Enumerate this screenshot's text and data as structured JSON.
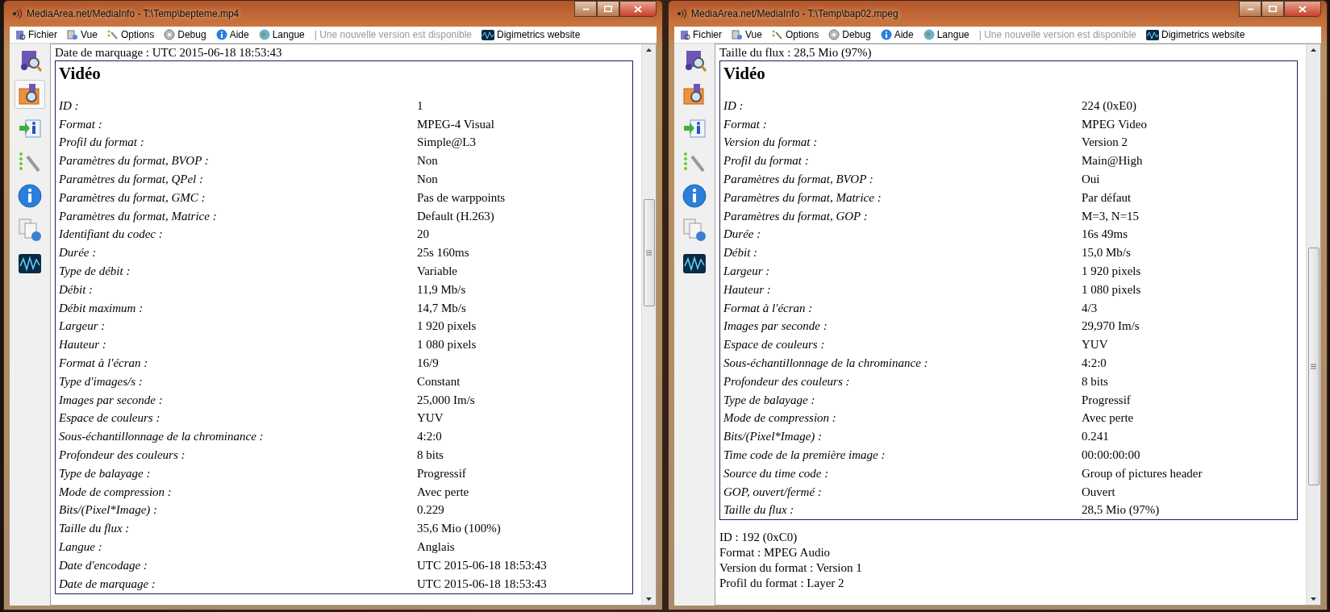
{
  "windows": [
    {
      "title": "MediaArea.net/MediaInfo - T:\\Temp\\bepteme.mp4",
      "menu": [
        {
          "kind": "fichier",
          "label": "Fichier"
        },
        {
          "kind": "vue",
          "label": "Vue"
        },
        {
          "kind": "options",
          "label": "Options"
        },
        {
          "kind": "debug",
          "label": "Debug"
        },
        {
          "kind": "aide",
          "label": "Aide"
        },
        {
          "kind": "langue",
          "label": "Langue"
        }
      ],
      "update_notice": "| Une nouvelle version est disponible",
      "website": "Digimetrics website",
      "sidebar": [
        {
          "selected": false
        },
        {
          "selected": true
        },
        {
          "selected": false
        },
        {
          "selected": false
        },
        {
          "selected": false
        },
        {
          "selected": false
        },
        {
          "selected": false
        }
      ],
      "header_line": "Date de marquage : UTC 2015-06-18 18:53:43",
      "section": {
        "title": "Vidéo",
        "rows": [
          {
            "label": "ID :",
            "value": "1"
          },
          {
            "label": "Format :",
            "value": "MPEG-4 Visual"
          },
          {
            "label": "Profil du format :",
            "value": "Simple@L3"
          },
          {
            "label": "Paramètres du format, BVOP :",
            "value": "Non"
          },
          {
            "label": "Paramètres du format, QPel :",
            "value": "Non"
          },
          {
            "label": "Paramètres du format, GMC :",
            "value": "Pas de warppoints"
          },
          {
            "label": "Paramètres du format, Matrice :",
            "value": "Default (H.263)"
          },
          {
            "label": "Identifiant du codec :",
            "value": "20"
          },
          {
            "label": "Durée :",
            "value": "25s 160ms"
          },
          {
            "label": "Type de débit :",
            "value": "Variable"
          },
          {
            "label": "Débit :",
            "value": "11,9 Mb/s"
          },
          {
            "label": "Débit maximum :",
            "value": "14,7 Mb/s"
          },
          {
            "label": "Largeur :",
            "value": "1 920 pixels"
          },
          {
            "label": "Hauteur :",
            "value": "1 080 pixels"
          },
          {
            "label": "Format à l'écran :",
            "value": "16/9"
          },
          {
            "label": "Type d'images/s :",
            "value": "Constant"
          },
          {
            "label": "Images par seconde :",
            "value": "25,000 Im/s"
          },
          {
            "label": "Espace de couleurs :",
            "value": "YUV"
          },
          {
            "label": "Sous-échantillonnage de la chrominance :",
            "value": "4:2:0"
          },
          {
            "label": "Profondeur des couleurs :",
            "value": "8 bits"
          },
          {
            "label": "Type de balayage :",
            "value": "Progressif"
          },
          {
            "label": "Mode de compression :",
            "value": "Avec perte"
          },
          {
            "label": "Bits/(Pixel*Image) :",
            "value": "0.229"
          },
          {
            "label": "Taille du flux :",
            "value": "35,6 Mio (100%)"
          },
          {
            "label": "Langue :",
            "value": "Anglais"
          },
          {
            "label": "Date d'encodage :",
            "value": "UTC 2015-06-18 18:53:43"
          },
          {
            "label": "Date de marquage :",
            "value": "UTC 2015-06-18 18:53:43"
          }
        ]
      }
    },
    {
      "title": "MediaArea.net/MediaInfo - T:\\Temp\\bap02.mpeg",
      "menu": [
        {
          "kind": "fichier",
          "label": "Fichier"
        },
        {
          "kind": "vue",
          "label": "Vue"
        },
        {
          "kind": "options",
          "label": "Options"
        },
        {
          "kind": "debug",
          "label": "Debug"
        },
        {
          "kind": "aide",
          "label": "Aide"
        },
        {
          "kind": "langue",
          "label": "Langue"
        }
      ],
      "update_notice": "| Une nouvelle version est disponible",
      "website": "Digimetrics website",
      "sidebar": [
        {
          "selected": false
        },
        {
          "selected": false
        },
        {
          "selected": false
        },
        {
          "selected": false
        },
        {
          "selected": false
        },
        {
          "selected": false
        },
        {
          "selected": false
        }
      ],
      "header_line": "Taille du flux : 28,5 Mio (97%)",
      "section": {
        "title": "Vidéo",
        "rows": [
          {
            "label": "ID :",
            "value": "224 (0xE0)"
          },
          {
            "label": "Format :",
            "value": "MPEG Video"
          },
          {
            "label": "Version du format :",
            "value": "Version 2"
          },
          {
            "label": "Profil du format :",
            "value": "Main@High"
          },
          {
            "label": "Paramètres du format, BVOP :",
            "value": "Oui"
          },
          {
            "label": "Paramètres du format, Matrice :",
            "value": "Par défaut"
          },
          {
            "label": "Paramètres du format, GOP :",
            "value": "M=3, N=15"
          },
          {
            "label": "Durée :",
            "value": "16s 49ms"
          },
          {
            "label": "Débit :",
            "value": "15,0 Mb/s"
          },
          {
            "label": "Largeur :",
            "value": "1 920 pixels"
          },
          {
            "label": "Hauteur :",
            "value": "1 080 pixels"
          },
          {
            "label": "Format à l'écran :",
            "value": "4/3"
          },
          {
            "label": "Images par seconde :",
            "value": "29,970 Im/s"
          },
          {
            "label": "Espace de couleurs :",
            "value": "YUV"
          },
          {
            "label": "Sous-échantillonnage de la chrominance :",
            "value": "4:2:0"
          },
          {
            "label": "Profondeur des couleurs :",
            "value": "8 bits"
          },
          {
            "label": "Type de balayage :",
            "value": "Progressif"
          },
          {
            "label": "Mode de compression :",
            "value": "Avec perte"
          },
          {
            "label": "Bits/(Pixel*Image) :",
            "value": "0.241"
          },
          {
            "label": "Time code de la première image :",
            "value": "00:00:00:00"
          },
          {
            "label": "Source du time code :",
            "value": "Group of pictures header"
          },
          {
            "label": "GOP, ouvert/fermé :",
            "value": "Ouvert"
          },
          {
            "label": "Taille du flux :",
            "value": "28,5 Mio (97%)"
          }
        ]
      },
      "after_lines": [
        "ID : 192 (0xC0)",
        "Format : MPEG Audio",
        "Version du format : Version 1",
        "Profil du format : Layer 2"
      ]
    }
  ]
}
